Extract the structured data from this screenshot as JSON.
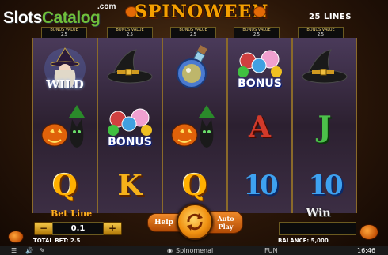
{
  "logo": {
    "slots": "Slots",
    "catalog": "Catalog",
    "com": ".com"
  },
  "title": "SPINOWEEN",
  "lines": "25 LINES",
  "bonus_values": [
    {
      "label": "BONUS VALUE",
      "value": "2.5"
    },
    {
      "label": "BONUS VALUE",
      "value": "2.5"
    },
    {
      "label": "BONUS VALUE",
      "value": "2.5"
    },
    {
      "label": "BONUS VALUE",
      "value": "2.5"
    },
    {
      "label": "BONUS VALUE",
      "value": "2.5"
    }
  ],
  "reels": [
    [
      "wild",
      "pumpkin-cat",
      "Q"
    ],
    [
      "witch-hat",
      "bonus",
      "K"
    ],
    [
      "potion",
      "pumpkin-cat",
      "Q"
    ],
    [
      "bonus",
      "A",
      "10"
    ],
    [
      "witch-hat",
      "J",
      "10"
    ]
  ],
  "symbol_text": {
    "wild": "WILD",
    "bonus": "BONUS"
  },
  "controls": {
    "bet_label": "Bet Line",
    "bet_value": "0.1",
    "minus": "−",
    "plus": "+",
    "help": "Help",
    "autoplay": "Auto Play",
    "win_label": "Win",
    "win_value": "",
    "total_bet": "TOTAL BET: 2.5",
    "balance": "BALANCE: 5,000"
  },
  "statusbar": {
    "brand": "Spinomenal",
    "mode": "FUN",
    "time": "16:46"
  },
  "colors": {
    "accent": "#f5a000",
    "reel_bg": "#2c2030",
    "label_bg": "#0b0b0b"
  }
}
